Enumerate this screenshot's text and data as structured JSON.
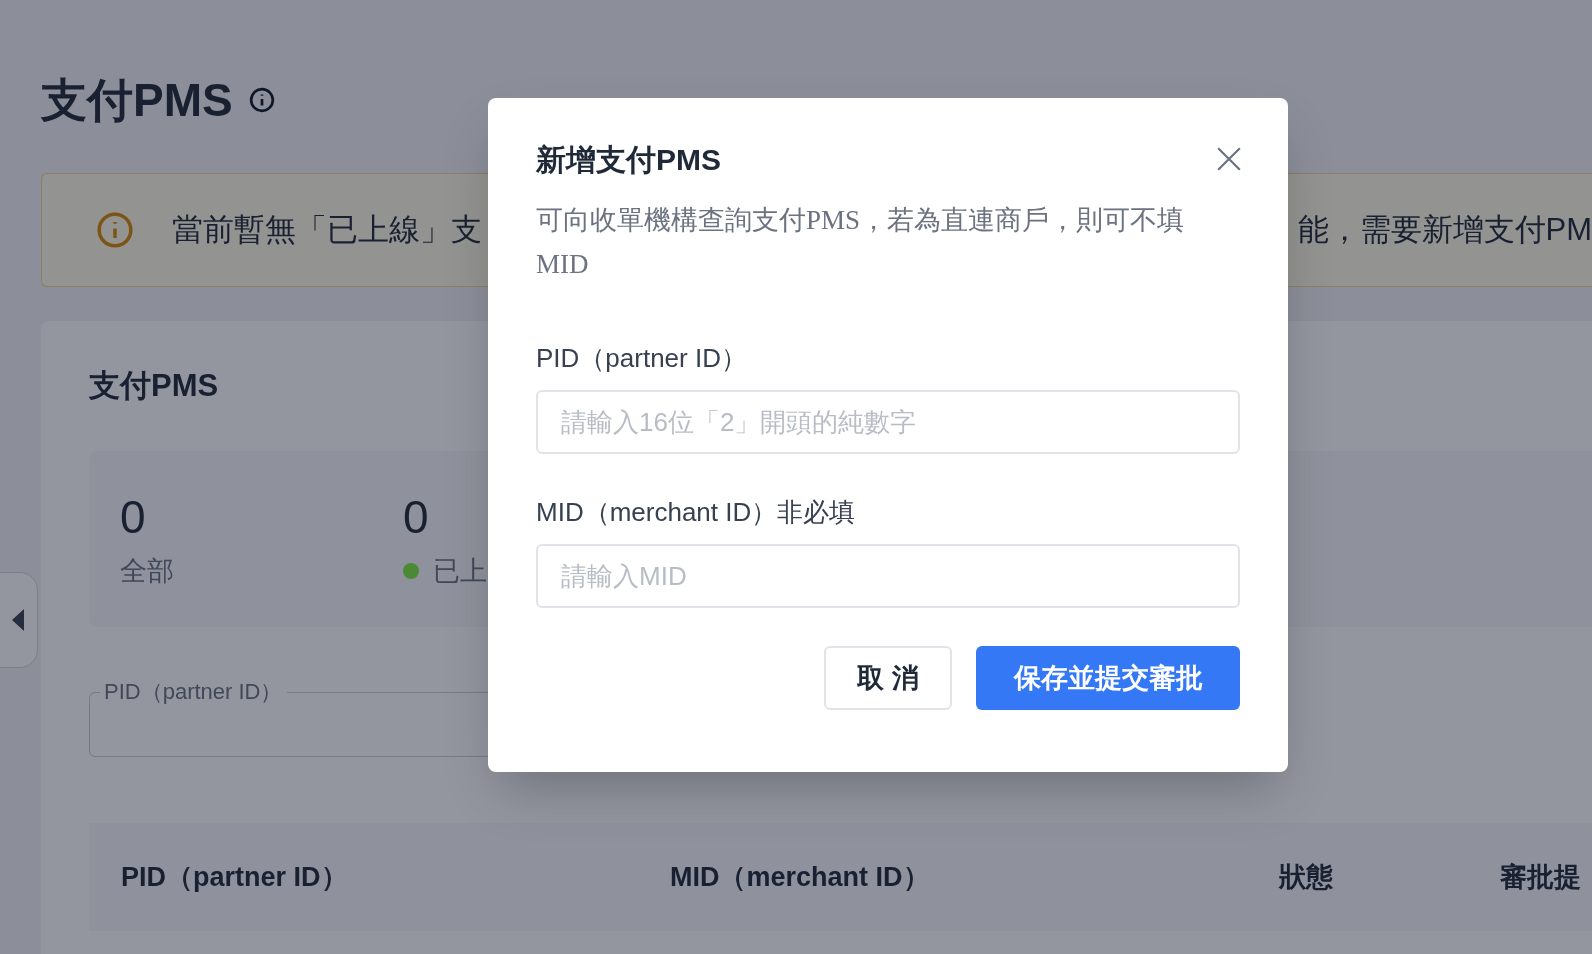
{
  "page": {
    "title": "支付PMS",
    "alert": {
      "text_left": "當前暫無「已上線」支",
      "text_right": "能，需要新增支付PM"
    },
    "card": {
      "title": "支付PMS",
      "stats": [
        {
          "value": "0",
          "label": "全部"
        },
        {
          "value": "0",
          "label": "已上",
          "color": "#4b8a35"
        }
      ],
      "filter": {
        "label": "PID（partner ID）"
      },
      "table": {
        "columns": [
          "PID（partner ID）",
          "MID（merchant ID）",
          "狀態",
          "審批提"
        ]
      }
    }
  },
  "dialog": {
    "title": "新增支付PMS",
    "description": "可向收單機構查詢支付PMS，若為直連商戶，則可不填MID",
    "fields": [
      {
        "label": "PID（partner ID）",
        "placeholder": "請輸入16位「2」開頭的純數字"
      },
      {
        "label": "MID（merchant ID）非必填",
        "placeholder": "請輸入MID"
      }
    ],
    "buttons": [
      {
        "kind": "secondary",
        "label": "取 消"
      },
      {
        "kind": "primary",
        "label": "保存並提交審批"
      }
    ]
  }
}
